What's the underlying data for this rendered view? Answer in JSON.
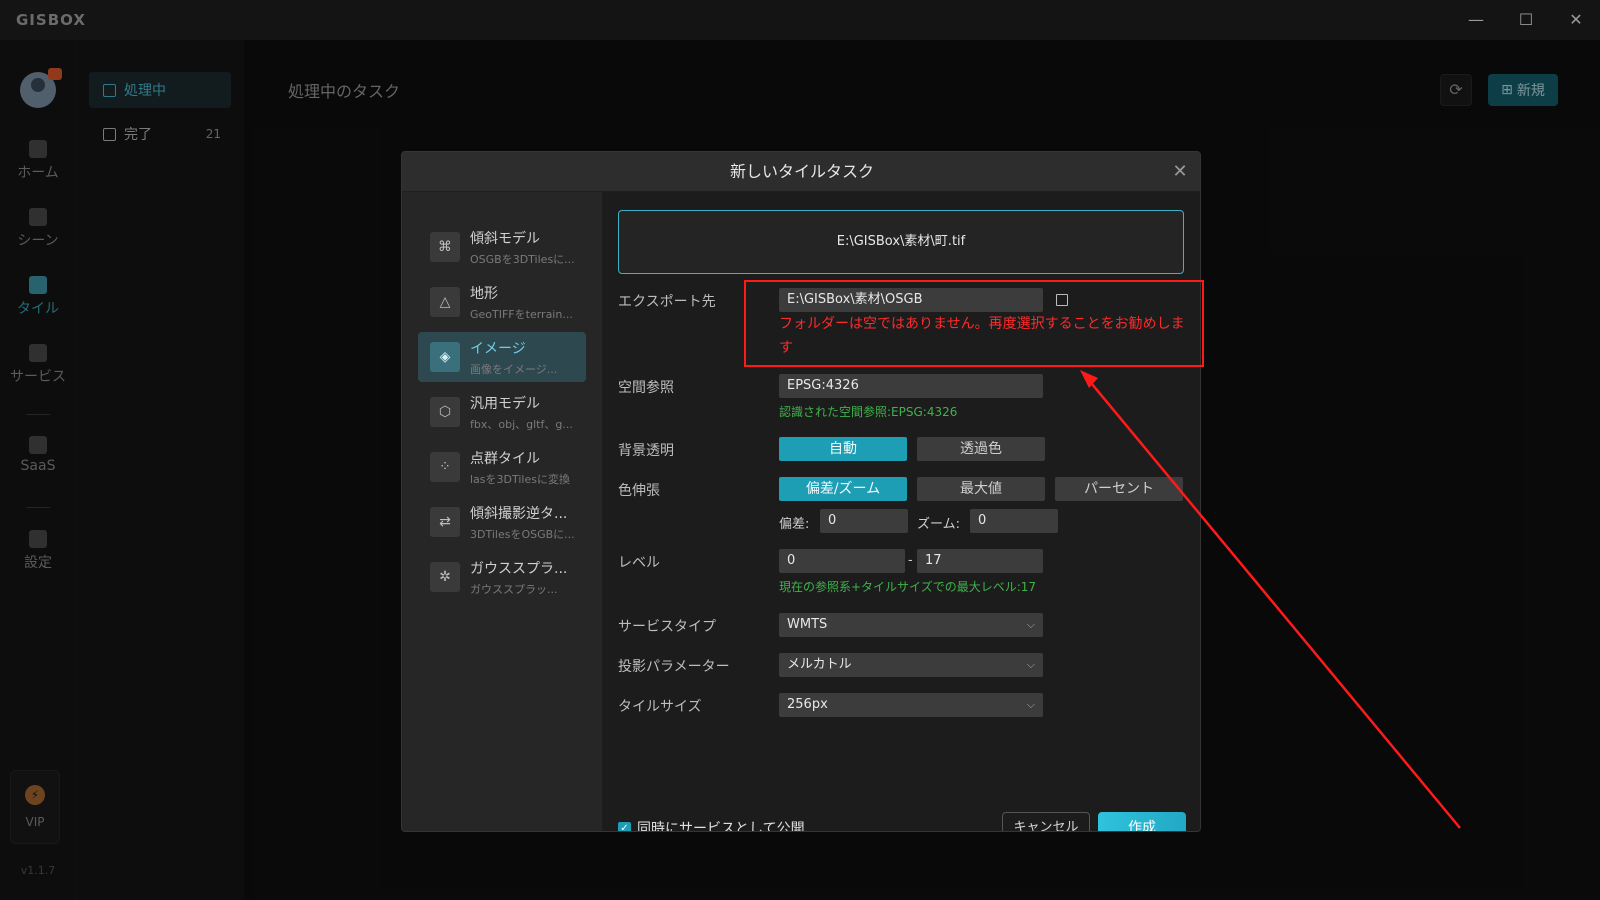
{
  "app": {
    "logo": "GISBOX",
    "version": "v1.1.7"
  },
  "window": {
    "minimize": "—",
    "maximize": "☐",
    "close": "✕"
  },
  "rail": {
    "items": [
      {
        "label": "ホーム"
      },
      {
        "label": "シーン"
      },
      {
        "label": "タイル"
      },
      {
        "label": "サービス"
      },
      {
        "label": "SaaS"
      },
      {
        "label": "設定"
      }
    ],
    "vip": "VIP"
  },
  "sidebar": {
    "items": [
      {
        "label": "処理中",
        "count": ""
      },
      {
        "label": "完了",
        "count": "21"
      }
    ]
  },
  "main": {
    "title": "処理中のタスク",
    "new_label": "新規"
  },
  "dialog": {
    "title": "新しいタイルタスク",
    "types": [
      {
        "name": "傾斜モデル",
        "desc": "OSGBを3DTilesに..."
      },
      {
        "name": "地形",
        "desc": "GeoTIFFをterrain..."
      },
      {
        "name": "イメージ",
        "desc": "画像をイメージ..."
      },
      {
        "name": "汎用モデル",
        "desc": "fbx、obj、gltf、g..."
      },
      {
        "name": "点群タイル",
        "desc": "lasを3DTilesに変換"
      },
      {
        "name": "傾斜撮影逆タ...",
        "desc": "3DTilesをOSGBに..."
      },
      {
        "name": "ガウススプラ...",
        "desc": "ガウススプラッ..."
      }
    ],
    "file_path": "E:\\GISBox\\素材\\町.tif",
    "export": {
      "label": "エクスポート先",
      "value": "E:\\GISBox\\素材\\OSGB",
      "error": "フォルダーは空ではありません。再度選択することをお勧めします"
    },
    "srs": {
      "label": "空間参照",
      "value": "EPSG:4326",
      "hint": "認識された空間参照:EPSG:4326"
    },
    "bg": {
      "label": "背景透明",
      "options": [
        "自動",
        "透過色"
      ]
    },
    "stretch": {
      "label": "色伸張",
      "options": [
        "偏差/ズーム",
        "最大値",
        "パーセント"
      ],
      "dev_label": "偏差:",
      "dev_value": "0",
      "zoom_label": "ズーム:",
      "zoom_value": "0"
    },
    "level": {
      "label": "レベル",
      "min": "0",
      "sep": "-",
      "max": "17",
      "hint": "現在の参照系+タイルサイズでの最大レベル:17"
    },
    "service_type": {
      "label": "サービスタイプ",
      "value": "WMTS"
    },
    "projection": {
      "label": "投影パラメーター",
      "value": "メルカトル"
    },
    "tile_size": {
      "label": "タイルサイズ",
      "value": "256px"
    },
    "publish_label": "同時にサービスとして公開",
    "cancel_label": "キャンセル",
    "create_label": "作成"
  },
  "colors": {
    "accent": "#1e9eb4",
    "error": "#ff2a2a",
    "success": "#3fb24a",
    "annotation": "#ff1a1a"
  }
}
